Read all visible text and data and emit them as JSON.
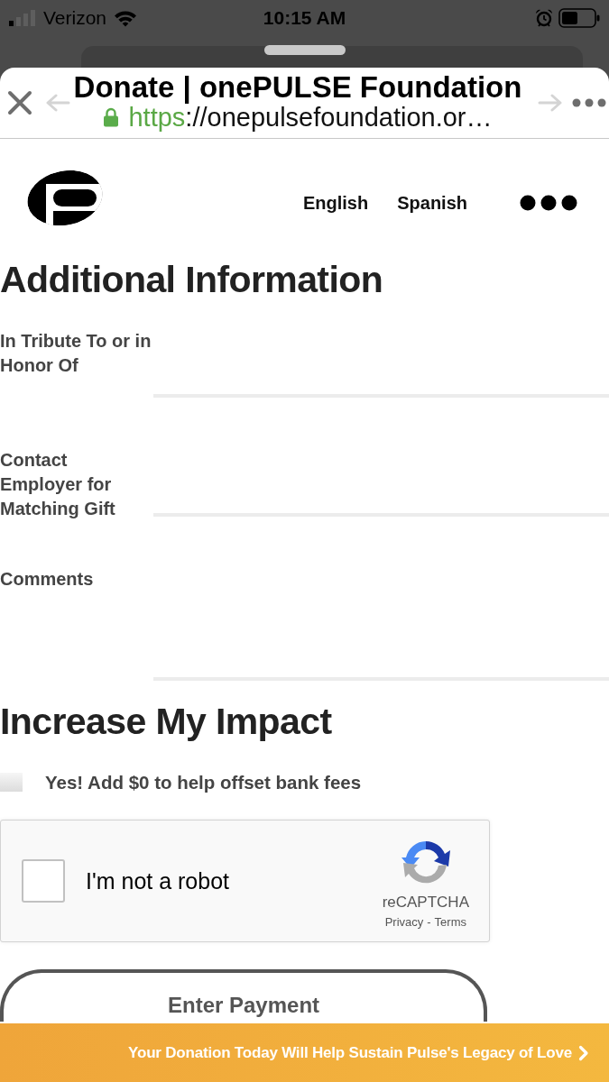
{
  "status_bar": {
    "carrier": "Verizon",
    "time": "10:15 AM"
  },
  "browser": {
    "title": "Donate | onePULSE Foundation",
    "url_scheme": "https",
    "url_rest": "://onepulsefoundation.or…"
  },
  "site_nav": {
    "languages": [
      "English",
      "Spanish"
    ]
  },
  "additional_information": {
    "heading": "Additional Information",
    "fields": [
      {
        "label": "In Tribute To or in Honor Of",
        "kind": "input"
      },
      {
        "label": "Contact Employer for Matching Gift",
        "kind": "input"
      },
      {
        "label": "Comments",
        "kind": "textarea"
      }
    ]
  },
  "increase_impact": {
    "heading": "Increase My Impact",
    "offset_fees": {
      "label": "Yes! Add $0 to help offset bank fees",
      "checked": false
    }
  },
  "recaptcha": {
    "label": "I'm not a robot",
    "checked": false,
    "brand": "reCAPTCHA",
    "links": [
      "Privacy",
      "Terms"
    ],
    "separator": "-"
  },
  "submit_button": {
    "label": "Enter Payment"
  },
  "banner": {
    "text": "Your Donation Today Will Help Sustain Pulse's Legacy of Love"
  }
}
